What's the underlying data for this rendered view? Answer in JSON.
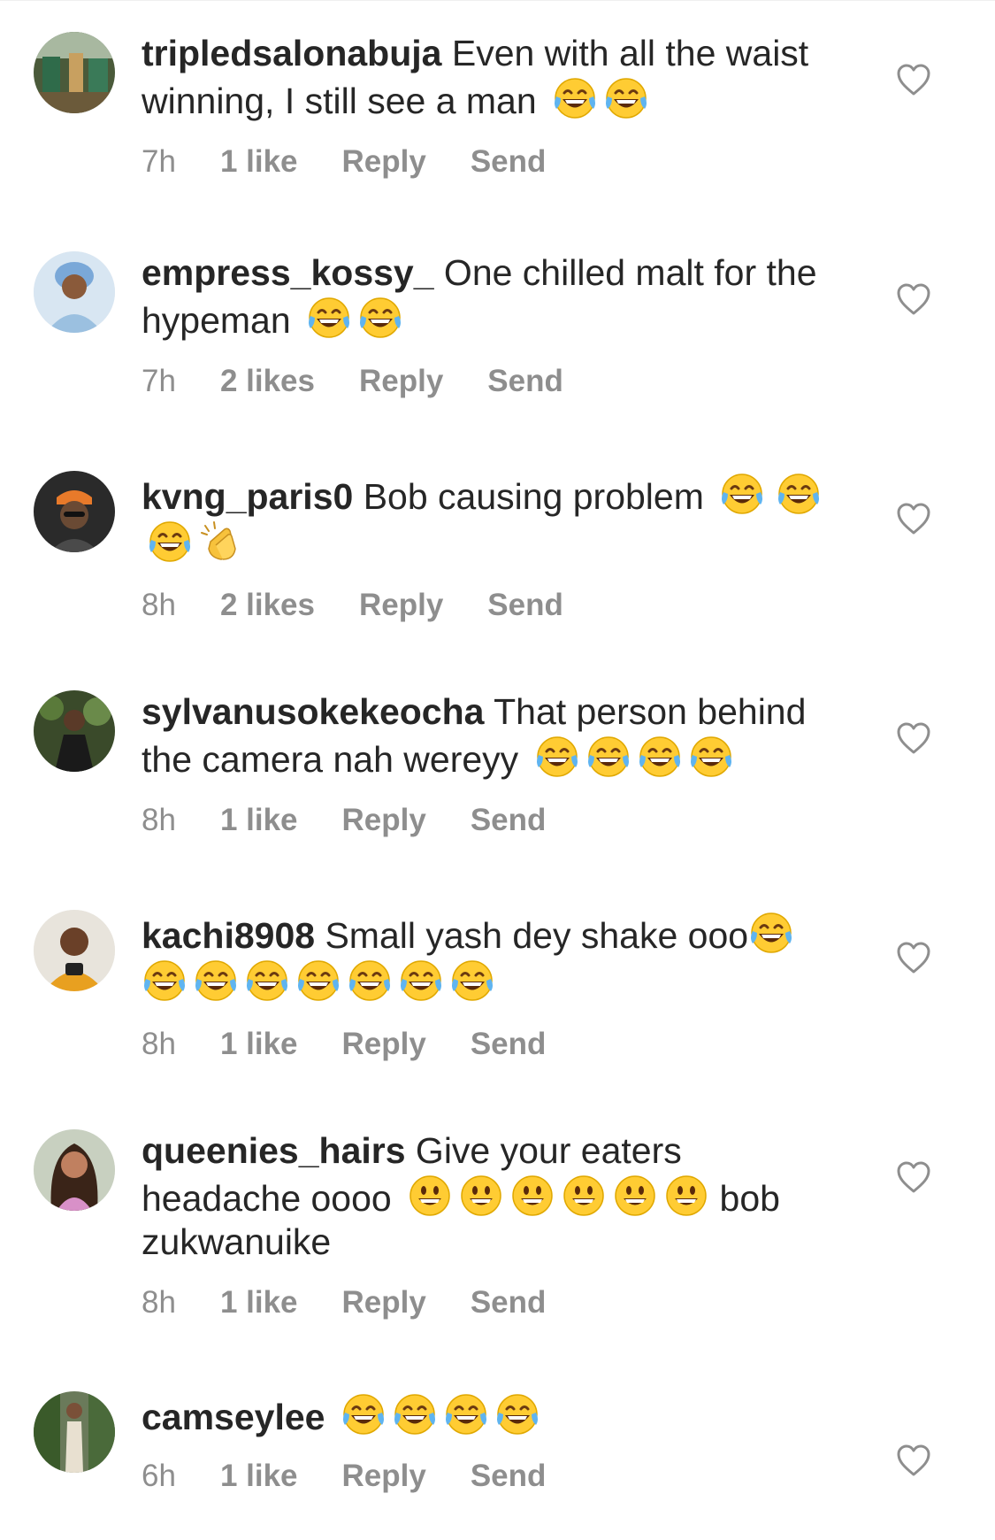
{
  "comments": [
    {
      "username": "tripledsalonabuja",
      "text": " Even with all the waist winning, I still see a man",
      "emojis": [
        "tears-of-joy",
        "tears-of-joy"
      ],
      "time": "7h",
      "likes": "1 like",
      "reply": "Reply",
      "send": "Send",
      "avatar": "salon-avatar"
    },
    {
      "username": "empress_kossy_",
      "text": " One chilled malt for the hypeman",
      "emojis": [
        "tears-of-joy",
        "tears-of-joy"
      ],
      "time": "7h",
      "likes": "2 likes",
      "reply": "Reply",
      "send": "Send",
      "avatar": "woman-headwrap-avatar"
    },
    {
      "username": "kvng_paris0",
      "text": " Bob causing problem",
      "emojis": [
        "tears-of-joy",
        "tears-of-joy",
        "tears-of-joy",
        "clapping-hands"
      ],
      "time": "8h",
      "likes": "2 likes",
      "reply": "Reply",
      "send": "Send",
      "avatar": "cartoon-man-avatar"
    },
    {
      "username": "sylvanusokekeocha",
      "text": " That person behind the camera nah wereyy",
      "emojis": [
        "tears-of-joy",
        "tears-of-joy",
        "tears-of-joy",
        "tears-of-joy"
      ],
      "time": "8h",
      "likes": "1 like",
      "reply": "Reply",
      "send": "Send",
      "avatar": "man-posing-avatar"
    },
    {
      "username": "kachi8908",
      "text": " Small yash dey shake ooo",
      "emojis": [
        "tears-of-joy",
        "tears-of-joy",
        "tears-of-joy",
        "tears-of-joy",
        "tears-of-joy",
        "tears-of-joy",
        "tears-of-joy",
        "tears-of-joy"
      ],
      "time": "8h",
      "likes": "1 like",
      "reply": "Reply",
      "send": "Send",
      "avatar": "man-phone-avatar"
    },
    {
      "username": "queenies_hairs",
      "text": " Give your eaters headache oooo",
      "emojis": [
        "grinning",
        "grinning",
        "grinning",
        "grinning",
        "grinning",
        "grinning"
      ],
      "text_after": " bob zukwanuike",
      "time": "8h",
      "likes": "1 like",
      "reply": "Reply",
      "send": "Send",
      "avatar": "woman-hair-avatar"
    },
    {
      "username": "camseylee",
      "text": "",
      "emojis": [
        "tears-of-joy",
        "tears-of-joy",
        "tears-of-joy",
        "tears-of-joy"
      ],
      "time": "6h",
      "likes": "1 like",
      "reply": "Reply",
      "send": "Send",
      "avatar": "woman-standing-avatar"
    }
  ],
  "icons": {
    "like": "heart-outline-icon"
  },
  "colors": {
    "text": "#262626",
    "meta": "#8e8e8e",
    "background": "#ffffff"
  }
}
